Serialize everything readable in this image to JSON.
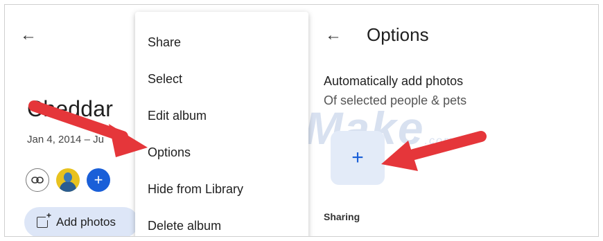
{
  "album": {
    "back_icon": "arrow-left-icon",
    "title": "Cheddar",
    "dates": "Jan 4, 2014 – Ju",
    "link_icon": "link-icon",
    "avatar_icon": "person-avatar-icon",
    "add_person_icon": "plus-icon",
    "add_photos_label": "Add photos",
    "add_photos_icon": "add-photo-icon"
  },
  "menu": {
    "items": [
      {
        "label": "Share"
      },
      {
        "label": "Select"
      },
      {
        "label": "Edit album"
      },
      {
        "label": "Options"
      },
      {
        "label": "Hide from Library"
      },
      {
        "label": "Delete album"
      }
    ]
  },
  "options": {
    "back_icon": "arrow-left-icon",
    "title": "Options",
    "auto_add_title": "Automatically add photos",
    "auto_add_subtitle": "Of selected people & pets",
    "add_tile_symbol": "+",
    "sharing_label": "Sharing"
  },
  "watermark": {
    "text": "TipsMake",
    "suffix": ".com"
  },
  "colors": {
    "accent": "#1a5fd8",
    "annotation_arrow": "#e5363a",
    "chip_bg": "#dde6f7"
  }
}
